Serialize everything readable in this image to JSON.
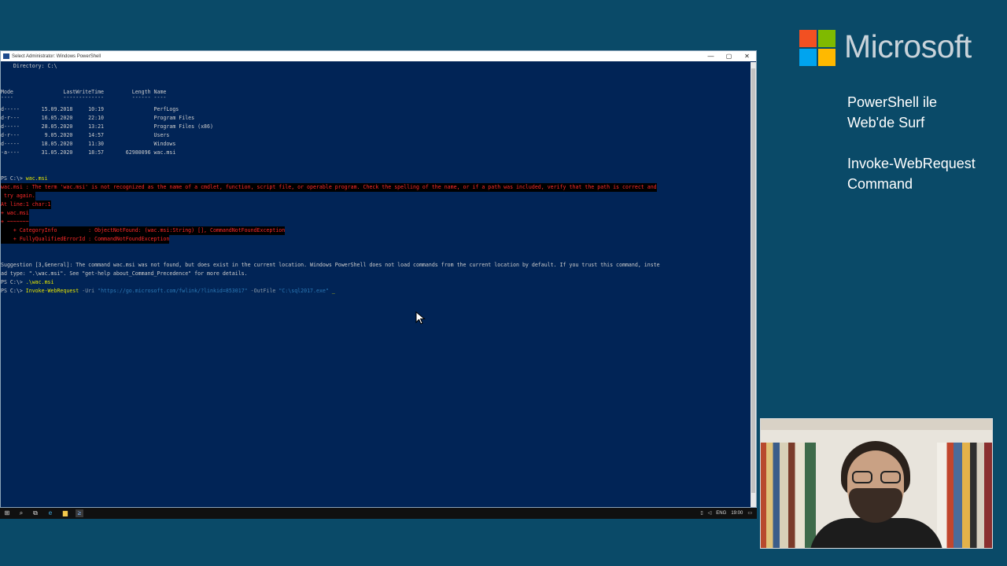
{
  "window": {
    "title": "Select Administrator: Windows PowerShell",
    "controls": {
      "minimize": "—",
      "maximize": "▢",
      "close": "✕"
    }
  },
  "console": {
    "directory_line": "    Directory: C:\\",
    "header_line": "Mode                LastWriteTime         Length Name",
    "separator_line": "----                -------------         ------ ----",
    "rows": [
      "d-----       15.09.2018     10:19                PerfLogs",
      "d-r---       16.05.2020     22:10                Program Files",
      "d-----       28.05.2020     13:21                Program Files (x86)",
      "d-r---        9.05.2020     14:57                Users",
      "d-----       18.05.2020     11:30                Windows",
      "-a----       31.05.2020     18:57       62980096 wac.msi"
    ],
    "prompt1": "PS C:\\> ",
    "cmd1": "wac.msi",
    "error_lines": [
      "wac.msi : The term 'wac.msi' is not recognized as the name of a cmdlet, function, script file, or operable program. Check the spelling of the name, or if a path was included, verify that the path is correct and",
      " try again.",
      "At line:1 char:1",
      "+ wac.msi",
      "+ ~~~~~~~",
      "    + CategoryInfo          : ObjectNotFound: (wac.msi:String) [], CommandNotFoundException",
      "    + FullyQualifiedErrorId : CommandNotFoundException"
    ],
    "suggestion_lines": [
      "Suggestion [3,General]: The command wac.msi was not found, but does exist in the current location. Windows PowerShell does not load commands from the current location by default. If you trust this command, inste",
      "ad type: \".\\wac.msi\". See \"get-help about_Command_Precedence\" for more details."
    ],
    "prompt2": "PS C:\\> ",
    "cmd2": ".\\wac.msi",
    "prompt3": "PS C:\\> ",
    "cmd3_name": "Invoke-WebRequest",
    "cmd3_param1": " -Uri ",
    "cmd3_url": "\"https://go.microsoft.com/fwlink/?linkid=853017\"",
    "cmd3_param2": " -OutFile ",
    "cmd3_path": "\"C:\\sql2017.exe\"",
    "cursor": " _"
  },
  "taskbar": {
    "start_icon": "⊞",
    "search_icon": "⌕",
    "taskview_icon": "⧉",
    "ie_icon": "e",
    "explorer_icon": "▆",
    "powershell_icon": "≥",
    "tray": {
      "network": "▯",
      "volume": "◁",
      "lang": "ENG",
      "clock": "19:00",
      "notifications": "▭"
    }
  },
  "branding": {
    "company": "Microsoft",
    "colors": {
      "red": "#f25022",
      "green": "#7fba00",
      "blue": "#00a4ef",
      "yellow": "#ffb900"
    },
    "title_line1": "PowerShell ile",
    "title_line2": "Web'de Surf",
    "subtitle_line1": "Invoke-WebRequest",
    "subtitle_line2": "Command"
  }
}
